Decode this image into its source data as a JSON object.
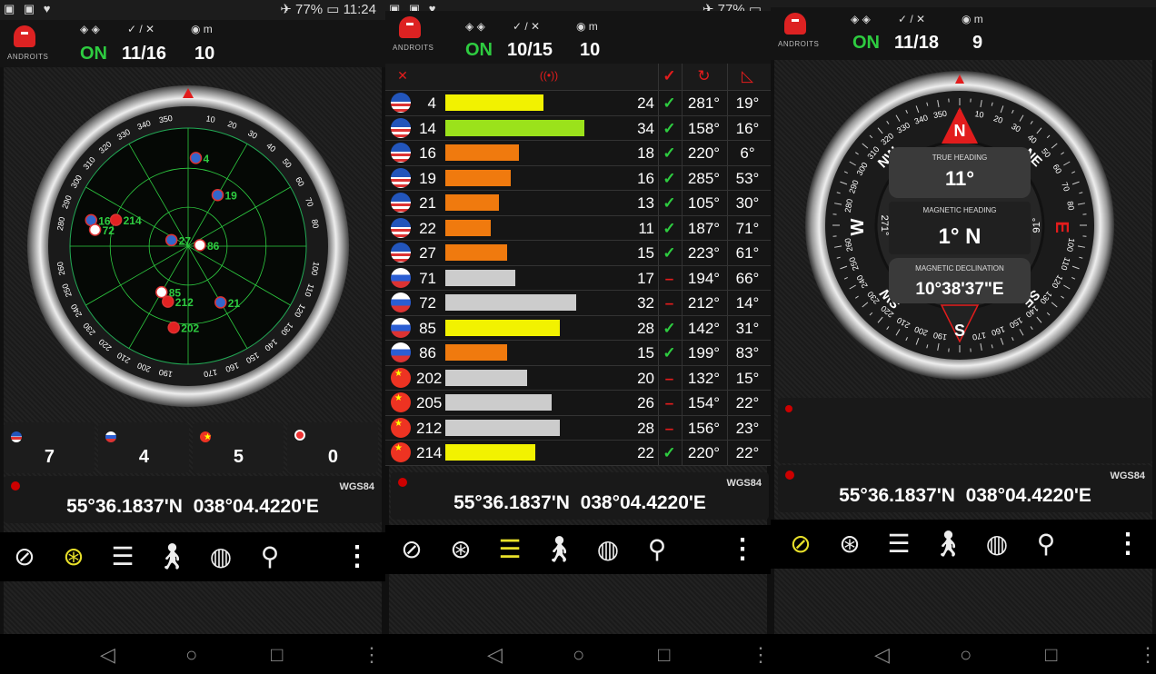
{
  "status_bar": {
    "battery": "77%",
    "time": "11:24"
  },
  "header": {
    "sym_status": "◈ ◈",
    "sym_sats": "✓ / ✕",
    "sym_alt": "◉ m",
    "screens": [
      {
        "status": "ON",
        "sats": "11/16",
        "alt": "10"
      },
      {
        "status": "ON",
        "sats": "10/15",
        "alt": "10"
      },
      {
        "status": "ON",
        "sats": "11/18",
        "alt": "9"
      }
    ]
  },
  "logo_text": "ANDROITS",
  "radar": {
    "bearing_labels": [
      "280",
      "290",
      "300",
      "310",
      "320",
      "330",
      "340",
      "350",
      "10",
      "20",
      "30",
      "40",
      "50",
      "60",
      "70",
      "80",
      "100",
      "110",
      "120",
      "130",
      "140",
      "150",
      "160",
      "170",
      "190",
      "200",
      "210",
      "220",
      "230",
      "240",
      "250",
      "260"
    ],
    "sats": [
      {
        "label": "4",
        "az": 5,
        "r": 0.75,
        "flag": "us"
      },
      {
        "label": "19",
        "az": 30,
        "r": 0.5,
        "flag": "us"
      },
      {
        "label": "16",
        "az": 285,
        "r": 0.85,
        "flag": "us"
      },
      {
        "label": "214",
        "az": 290,
        "r": 0.65,
        "flag": "cn"
      },
      {
        "label": "72",
        "az": 280,
        "r": 0.8,
        "flag": "ru"
      },
      {
        "label": "27",
        "az": 290,
        "r": 0.15,
        "flag": "us"
      },
      {
        "label": "86",
        "az": 85,
        "r": 0.1,
        "flag": "ru"
      },
      {
        "label": "212",
        "az": 200,
        "r": 0.5,
        "flag": "cn"
      },
      {
        "label": "85",
        "az": 210,
        "r": 0.45,
        "flag": "ru"
      },
      {
        "label": "21",
        "az": 150,
        "r": 0.55,
        "flag": "us"
      },
      {
        "label": "202",
        "az": 190,
        "r": 0.7,
        "flag": "cn"
      }
    ]
  },
  "counts": [
    {
      "flag": "us",
      "value": "7"
    },
    {
      "flag": "ru",
      "value": "4"
    },
    {
      "flag": "cn",
      "value": "5"
    },
    {
      "flag": "other",
      "value": "0"
    }
  ],
  "table": {
    "rows": [
      {
        "flag": "us",
        "prn": "4",
        "snr": "24",
        "used": true,
        "az": "281°",
        "el": "19°",
        "color": "#f2f200"
      },
      {
        "flag": "us",
        "prn": "14",
        "snr": "34",
        "used": true,
        "az": "158°",
        "el": "16°",
        "color": "#9be21b"
      },
      {
        "flag": "us",
        "prn": "16",
        "snr": "18",
        "used": true,
        "az": "220°",
        "el": "6°",
        "color": "#f07a0e"
      },
      {
        "flag": "us",
        "prn": "19",
        "snr": "16",
        "used": true,
        "az": "285°",
        "el": "53°",
        "color": "#f07a0e"
      },
      {
        "flag": "us",
        "prn": "21",
        "snr": "13",
        "used": true,
        "az": "105°",
        "el": "30°",
        "color": "#f07a0e"
      },
      {
        "flag": "us",
        "prn": "22",
        "snr": "11",
        "used": true,
        "az": "187°",
        "el": "71°",
        "color": "#f07a0e"
      },
      {
        "flag": "us",
        "prn": "27",
        "snr": "15",
        "used": true,
        "az": "223°",
        "el": "61°",
        "color": "#f07a0e"
      },
      {
        "flag": "ru",
        "prn": "71",
        "snr": "17",
        "used": false,
        "az": "194°",
        "el": "66°",
        "color": "#cccccc"
      },
      {
        "flag": "ru",
        "prn": "72",
        "snr": "32",
        "used": false,
        "az": "212°",
        "el": "14°",
        "color": "#cccccc"
      },
      {
        "flag": "ru",
        "prn": "85",
        "snr": "28",
        "used": true,
        "az": "142°",
        "el": "31°",
        "color": "#f2f200"
      },
      {
        "flag": "ru",
        "prn": "86",
        "snr": "15",
        "used": true,
        "az": "199°",
        "el": "83°",
        "color": "#f07a0e"
      },
      {
        "flag": "cn",
        "prn": "202",
        "snr": "20",
        "used": false,
        "az": "132°",
        "el": "15°",
        "color": "#cccccc"
      },
      {
        "flag": "cn",
        "prn": "205",
        "snr": "26",
        "used": false,
        "az": "154°",
        "el": "22°",
        "color": "#cccccc"
      },
      {
        "flag": "cn",
        "prn": "212",
        "snr": "28",
        "used": false,
        "az": "156°",
        "el": "23°",
        "color": "#cccccc"
      },
      {
        "flag": "cn",
        "prn": "214",
        "snr": "22",
        "used": true,
        "az": "220°",
        "el": "22°",
        "color": "#f2f200"
      }
    ],
    "used_mark": "✓",
    "unused_mark": "–"
  },
  "compass": {
    "true_heading_label": "TRUE HEADING",
    "true_heading": "11°",
    "magnetic_heading_label": "MAGNETIC HEADING",
    "magnetic_heading": "1° N",
    "declination_label": "MAGNETIC DECLINATION",
    "declination": "10°38'37\"E",
    "cardinals": {
      "n": "N",
      "s": "S",
      "e": "E",
      "w": "W",
      "ne": "NE",
      "nw": "NW",
      "se": "SE",
      "sw": "SW"
    },
    "side_values": {
      "left": "271°",
      "right": "91°"
    },
    "bearing_labels": [
      "0",
      "10",
      "20",
      "30",
      "40",
      "50",
      "60",
      "70",
      "80",
      "100",
      "110",
      "120",
      "130",
      "140",
      "150",
      "160",
      "170",
      "190",
      "200",
      "210",
      "220",
      "230",
      "240",
      "250",
      "260",
      "280",
      "290",
      "300",
      "310",
      "320",
      "330",
      "340",
      "350"
    ]
  },
  "location": {
    "datum": "WGS84",
    "lat": "55°36.1837'N",
    "lon": "038°04.4220'E"
  },
  "nav": {
    "icons": [
      "compass-icon",
      "radar-icon",
      "table-icon",
      "walk-icon",
      "globe-icon",
      "pin-icon"
    ],
    "more": "⋮",
    "active_per_screen": [
      1,
      2,
      0
    ]
  },
  "system_nav": {
    "back": "◁",
    "home": "○",
    "recent": "□",
    "more": "⋮"
  },
  "colors": {
    "on_green": "#2ecc40",
    "active_yellow": "#e8e02a",
    "red_needle": "#e21c1c",
    "radar_green": "#2ecc40"
  }
}
